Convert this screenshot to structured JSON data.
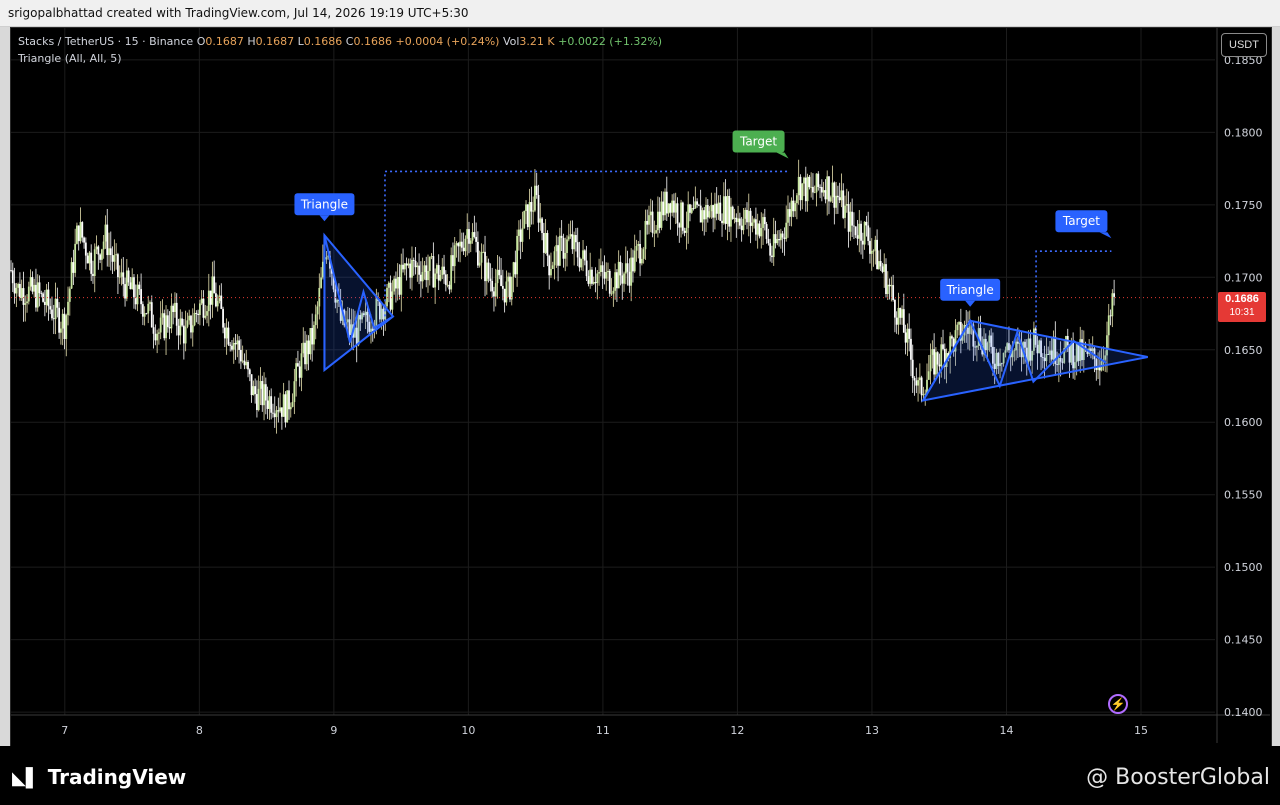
{
  "header": {
    "credit": "srigopalbhattad created with TradingView.com, Jul 14, 2026 19:19 UTC+5:30"
  },
  "legend": {
    "symbol": "Stacks / TetherUS · 15 · Binance",
    "o_label": "O",
    "o_val": "0.1687",
    "h_label": "H",
    "h_val": "0.1687",
    "l_label": "L",
    "l_val": "0.1686",
    "c_label": "C",
    "c_val": "0.1686",
    "change": "+0.0004 (+0.24%)",
    "vol_label": "Vol",
    "vol_val": "3.21 K",
    "vol_change": "+0.0022 (+1.32%)",
    "indicator": "Triangle (All, All, 5)"
  },
  "currency_button": "USDT",
  "current_price": {
    "value": "0.1686",
    "timer": "10:31"
  },
  "footer": {
    "logo": "TradingView",
    "brand": "@ BoosterGlobal"
  },
  "colors": {
    "background": "#000000",
    "candle_up": "#e8e2b0",
    "candle_down": "#ffffff",
    "pattern": "#2962ff",
    "label_triangle": "#2962ff",
    "label_target_green": "#4caf50",
    "price_tag": "#e53935"
  },
  "chart_data": {
    "type": "candlestick",
    "title": "",
    "xlabel": "",
    "ylabel": "",
    "x_ticks": [
      "7",
      "8",
      "9",
      "10",
      "11",
      "12",
      "13",
      "14",
      "15"
    ],
    "y_ticks": [
      "0.1850",
      "0.1800",
      "0.1750",
      "0.1700",
      "0.1650",
      "0.1600",
      "0.1550",
      "0.1500",
      "0.1450",
      "0.1400"
    ],
    "ylim": [
      0.1398,
      0.1872
    ],
    "xlim": [
      6.6,
      15.55
    ],
    "grid": true,
    "last_price": 0.1686,
    "price_path": [
      [
        6.6,
        0.1705
      ],
      [
        6.65,
        0.1692
      ],
      [
        6.8,
        0.1688
      ],
      [
        6.9,
        0.1678
      ],
      [
        7.0,
        0.1668
      ],
      [
        7.1,
        0.1735
      ],
      [
        7.2,
        0.171
      ],
      [
        7.3,
        0.1728
      ],
      [
        7.4,
        0.17
      ],
      [
        7.6,
        0.168
      ],
      [
        7.7,
        0.1662
      ],
      [
        7.8,
        0.1675
      ],
      [
        7.9,
        0.166
      ],
      [
        8.0,
        0.168
      ],
      [
        8.1,
        0.169
      ],
      [
        8.2,
        0.1665
      ],
      [
        8.3,
        0.165
      ],
      [
        8.4,
        0.162
      ],
      [
        8.55,
        0.1615
      ],
      [
        8.65,
        0.161
      ],
      [
        8.75,
        0.164
      ],
      [
        8.85,
        0.166
      ],
      [
        8.95,
        0.1725
      ],
      [
        9.05,
        0.167
      ],
      [
        9.15,
        0.166
      ],
      [
        9.3,
        0.1675
      ],
      [
        9.45,
        0.169
      ],
      [
        9.55,
        0.1708
      ],
      [
        9.7,
        0.1705
      ],
      [
        9.85,
        0.17
      ],
      [
        10.0,
        0.1735
      ],
      [
        10.15,
        0.17
      ],
      [
        10.3,
        0.169
      ],
      [
        10.4,
        0.1735
      ],
      [
        10.5,
        0.1755
      ],
      [
        10.6,
        0.171
      ],
      [
        10.75,
        0.1725
      ],
      [
        10.9,
        0.1705
      ],
      [
        11.05,
        0.1698
      ],
      [
        11.2,
        0.1705
      ],
      [
        11.35,
        0.1735
      ],
      [
        11.5,
        0.1755
      ],
      [
        11.6,
        0.1738
      ],
      [
        11.75,
        0.1745
      ],
      [
        11.9,
        0.1748
      ],
      [
        12.05,
        0.174
      ],
      [
        12.2,
        0.1735
      ],
      [
        12.25,
        0.1715
      ],
      [
        12.35,
        0.1735
      ],
      [
        12.45,
        0.1765
      ],
      [
        12.55,
        0.1758
      ],
      [
        12.65,
        0.1765
      ],
      [
        12.75,
        0.1755
      ],
      [
        12.85,
        0.1735
      ],
      [
        12.95,
        0.1732
      ],
      [
        13.1,
        0.17
      ],
      [
        13.25,
        0.166
      ],
      [
        13.35,
        0.162
      ],
      [
        13.45,
        0.164
      ],
      [
        13.6,
        0.1655
      ],
      [
        13.7,
        0.1665
      ],
      [
        13.8,
        0.166
      ],
      [
        13.9,
        0.1645
      ],
      [
        14.0,
        0.165
      ],
      [
        14.1,
        0.1648
      ],
      [
        14.2,
        0.1655
      ],
      [
        14.35,
        0.165
      ],
      [
        14.5,
        0.1648
      ],
      [
        14.6,
        0.1645
      ],
      [
        14.7,
        0.1642
      ],
      [
        14.75,
        0.166
      ],
      [
        14.8,
        0.1686
      ]
    ],
    "patterns": [
      {
        "label": "Triangle",
        "points": [
          [
            8.93,
            0.1636
          ],
          [
            8.93,
            0.1729
          ],
          [
            9.44,
            0.1673
          ]
        ],
        "zigzag": [
          [
            8.93,
            0.1636
          ],
          [
            8.93,
            0.1729
          ],
          [
            9.12,
            0.1655
          ],
          [
            9.22,
            0.169
          ],
          [
            9.3,
            0.1665
          ],
          [
            9.44,
            0.1673
          ]
        ]
      },
      {
        "label": "Triangle",
        "points": [
          [
            13.38,
            0.1615
          ],
          [
            13.73,
            0.167
          ],
          [
            15.05,
            0.1645
          ]
        ],
        "zigzag": [
          [
            13.38,
            0.1615
          ],
          [
            13.73,
            0.167
          ],
          [
            13.95,
            0.1625
          ],
          [
            14.08,
            0.1662
          ],
          [
            14.2,
            0.1628
          ],
          [
            14.5,
            0.1656
          ],
          [
            14.74,
            0.1641
          ]
        ]
      }
    ],
    "target_lines": [
      {
        "label": "Target",
        "from": [
          9.38,
          0.1673
        ],
        "level": 0.1773,
        "to_x": 12.38
      },
      {
        "label": "Target",
        "from": [
          14.22,
          0.1662
        ],
        "level": 0.1718,
        "to_x": 14.78
      }
    ]
  }
}
